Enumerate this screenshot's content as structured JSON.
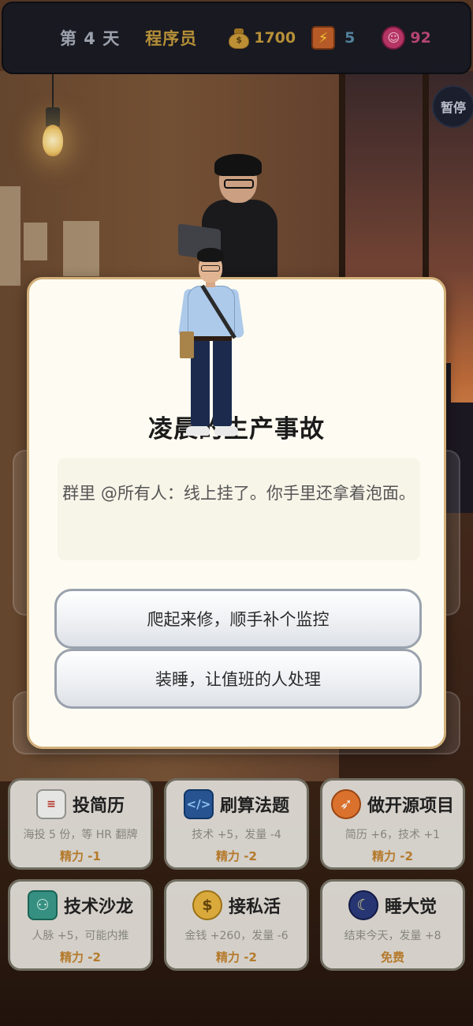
{
  "status_bar": {
    "day_label": "第 4 天",
    "role": "程序员",
    "money": "1700",
    "energy": "5",
    "mood": "92",
    "money_color": "#c39a3c",
    "energy_color": "#5a8aa6",
    "mood_color": "#c04a78"
  },
  "pause_button": {
    "label": "暂停"
  },
  "event_modal": {
    "title": "凌晨的生产事故",
    "description": "群里 @所有人：线上挂了。你手里还拿着泡面。",
    "choices": [
      {
        "label": "爬起来修，顺手补个监控"
      },
      {
        "label": "装睡，让值班的人处理"
      }
    ]
  },
  "actions": [
    {
      "icon": "resume-icon",
      "title": "投简历",
      "desc": "海投 5 份，等 HR 翻牌",
      "cost": "精力 -1"
    },
    {
      "icon": "code-laptop-icon",
      "title": "刷算法题",
      "desc": "技术 +5，发量 -4",
      "cost": "精力 -2"
    },
    {
      "icon": "rocket-icon",
      "title": "做开源项目",
      "desc": "简历 +6，技术 +1",
      "cost": "精力 -2"
    },
    {
      "icon": "handshake-icon",
      "title": "技术沙龙",
      "desc": "人脉 +5，可能内推",
      "cost": "精力 -2"
    },
    {
      "icon": "money-bag-icon",
      "title": "接私活",
      "desc": "金钱 +260，发量 -6",
      "cost": "精力 -2"
    },
    {
      "icon": "moon-icon",
      "title": "睡大觉",
      "desc": "结束今天，发量 +8",
      "cost": "免费"
    }
  ],
  "icon_glyphs": {
    "resume": "≡",
    "algo": "</>",
    "rocket": "➶",
    "salon": "⚇",
    "coin": "$",
    "moon": "☾",
    "energy": "⚡",
    "mood": "☺",
    "money": "$"
  }
}
